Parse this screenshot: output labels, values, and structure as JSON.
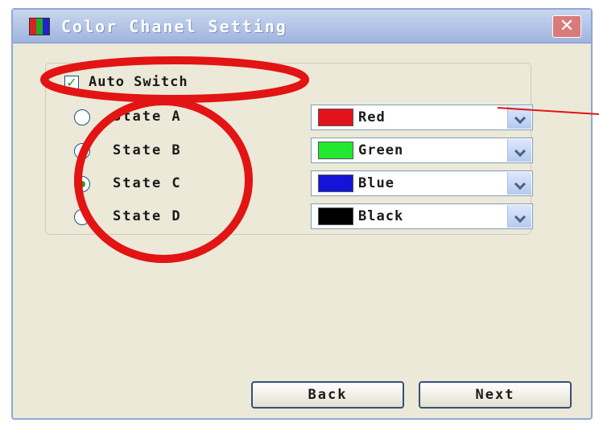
{
  "window": {
    "title": "Color Chanel Setting"
  },
  "titlebar": {
    "app_icon": "color-channels-icon",
    "close_icon": "close-icon",
    "close_glyph": "✕"
  },
  "auto_switch": {
    "label": "Auto Switch",
    "checked": true,
    "check_glyph": "✓"
  },
  "states": [
    {
      "label": "State A",
      "selected": false
    },
    {
      "label": "State B",
      "selected": false
    },
    {
      "label": "State C",
      "selected": true
    },
    {
      "label": "State D",
      "selected": false
    }
  ],
  "colors": [
    {
      "label": "Red",
      "swatch": "#e4121b"
    },
    {
      "label": "Green",
      "swatch": "#22e82f"
    },
    {
      "label": "Blue",
      "swatch": "#1414d8"
    },
    {
      "label": "Black",
      "swatch": "#000000"
    }
  ],
  "buttons": {
    "back_label": "Back",
    "next_label": "Next"
  },
  "annotation_color": "#e21414"
}
